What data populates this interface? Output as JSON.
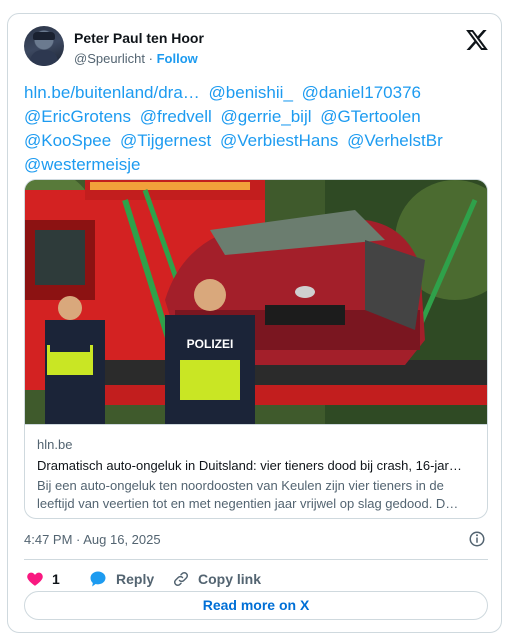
{
  "author": {
    "name": "Peter Paul ten Hoor",
    "handle": "@Speurlicht",
    "separator": "·",
    "follow_label": "Follow"
  },
  "tweet": {
    "tokens": [
      "hln.be/buitenland/dra…",
      "@benishii_",
      "@daniel170376",
      "@EricGrotens",
      "@fredvell",
      "@gerrie_bijl",
      "@GTertoolen",
      "@KooSpee",
      "@Tijgernest",
      "@VerbiestHans",
      "@VerhelstBr",
      "@westermeisje"
    ]
  },
  "link_card": {
    "domain": "hln.be",
    "title": "Dramatisch auto-ongeluk in Duitsland: vier tieners dood bij crash, 16-jar…",
    "description": "Bij een auto-ongeluk ten noordoosten van Keulen zijn vier tieners in de leeftijd van veertien tot en met negentien jaar vrijwel op slag gedood. D…",
    "photo_vest_text": "POLIZEI"
  },
  "meta": {
    "timestamp": "4:47 PM · Aug 16, 2025"
  },
  "actions": {
    "like_count": "1",
    "reply_label": "Reply",
    "copy_label": "Copy link"
  },
  "cta": {
    "read_more_label": "Read more on X"
  },
  "colors": {
    "accent": "#1d9bf0",
    "like": "#f91880",
    "border": "#cfd9de",
    "muted": "#536471"
  },
  "icons": [
    "x-logo-icon",
    "info-icon",
    "heart-icon",
    "reply-bubble-icon",
    "link-icon"
  ]
}
